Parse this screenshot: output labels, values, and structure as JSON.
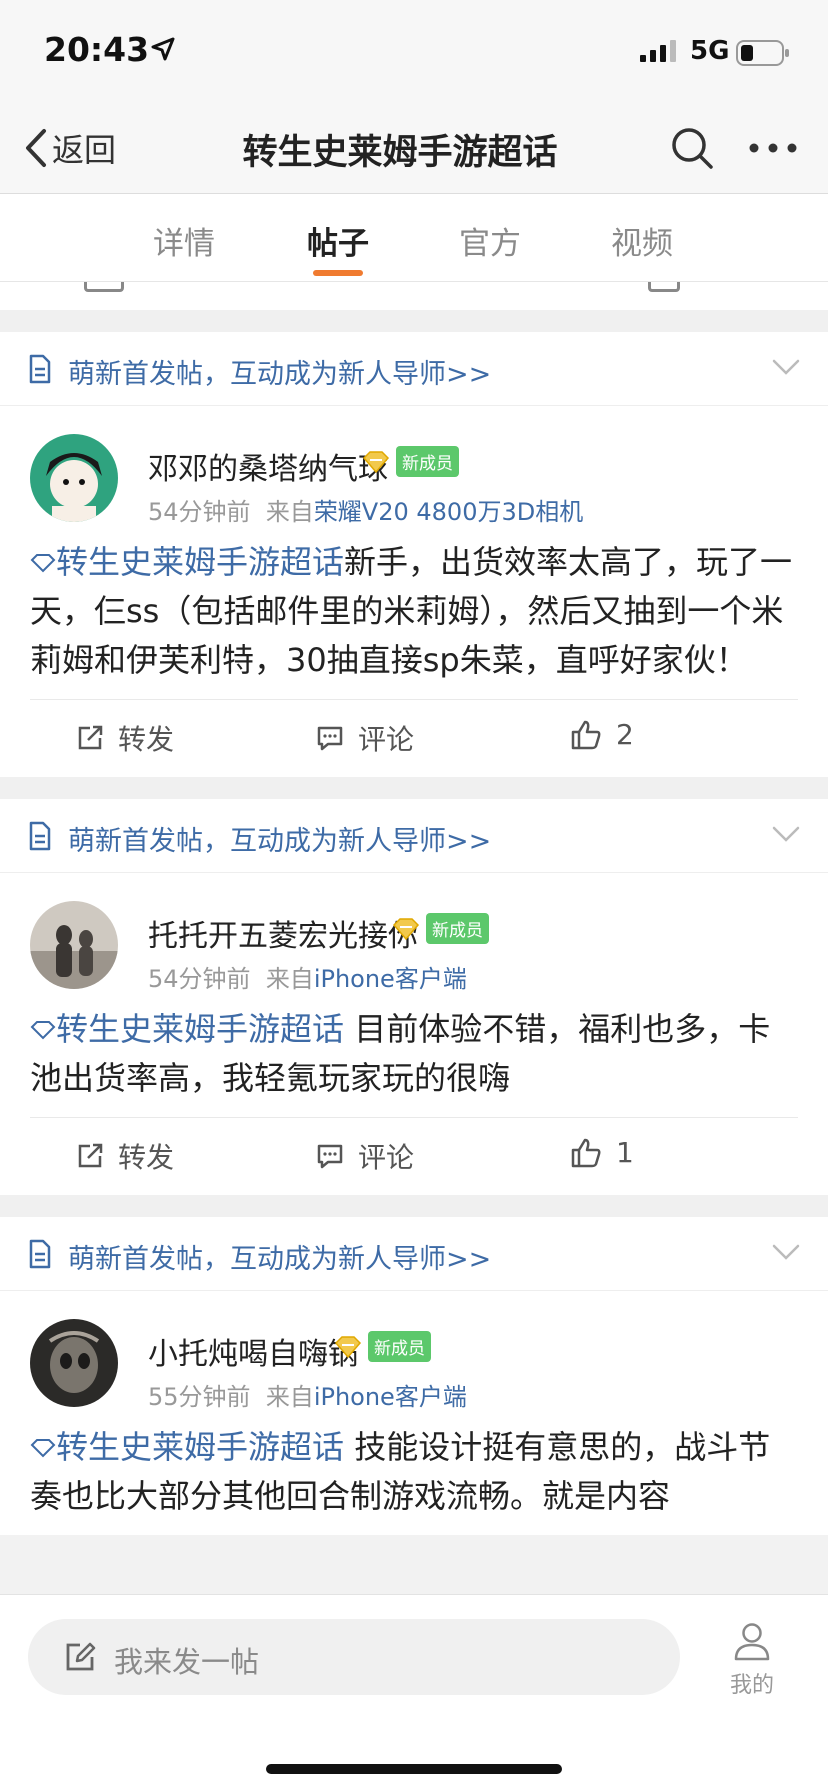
{
  "status": {
    "time": "20:43",
    "network": "5G"
  },
  "nav": {
    "back_label": "返回",
    "title": "转生史莱姆手游超话"
  },
  "tabs": [
    {
      "label": "详情"
    },
    {
      "label": "帖子"
    },
    {
      "label": "官方"
    },
    {
      "label": "视频"
    }
  ],
  "active_tab": "帖子",
  "notice_text": "萌新首发帖，互动成为新人导师>>",
  "new_member_badge": "新成员",
  "actions": {
    "repost": "转发",
    "comment": "评论"
  },
  "posts": [
    {
      "username": "邓邓的桑塔纳气球",
      "time_ago": "54分钟前",
      "from_prefix": "来自",
      "source": "荣耀V20 4800万3D相机",
      "topic": "转生史莱姆手游超话",
      "text": "新手，出货效率太高了，玩了一天，仨ss（包括邮件里的米莉姆），然后又抽到一个米莉姆和伊芙利特，30抽直接sp朱菜，直呼好家伙！",
      "likes": "2"
    },
    {
      "username": "托托开五菱宏光接你",
      "time_ago": "54分钟前",
      "from_prefix": "来自",
      "source": "iPhone客户端",
      "topic": "转生史莱姆手游超话",
      "text": " 目前体验不错，福利也多，卡池出货率高，我轻氪玩家玩的很嗨",
      "likes": "1"
    },
    {
      "username": "小托炖喝自嗨锅",
      "time_ago": "55分钟前",
      "from_prefix": "来自",
      "source": "iPhone客户端",
      "topic": "转生史莱姆手游超话",
      "text": " 技能设计挺有意思的，战斗节奏也比大部分其他回合制游戏流畅。就是内容"
    }
  ],
  "bottom": {
    "compose_placeholder": "我来发一帖",
    "me_label": "我的"
  },
  "colors": {
    "accent": "#f07b30",
    "link": "#3e6ba6",
    "badge": "#5cc86b"
  }
}
